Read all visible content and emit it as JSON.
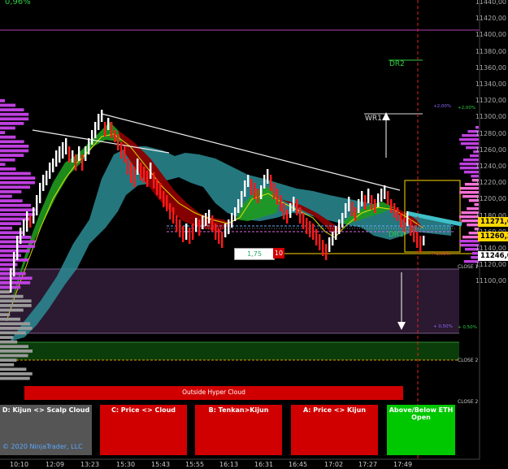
{
  "header": {
    "percent_change": "0,96%"
  },
  "price_axis": {
    "ticks": [
      "11440,00",
      "11420,00",
      "11400,00",
      "11380,00",
      "11360,00",
      "11340,00",
      "11320,00",
      "11300,00",
      "11280,00",
      "11260,00",
      "11240,00",
      "11220,00",
      "11200,00",
      "11180,00",
      "11160,00",
      "11140,00",
      "11120,00",
      "11100,00"
    ],
    "highlight_prices": [
      {
        "value": "11271,6",
        "color": "#ffd700"
      },
      {
        "value": "11260,3",
        "color": "#ffd700"
      },
      {
        "value": "11246,0",
        "color": "#ffffff"
      }
    ]
  },
  "time_axis": {
    "ticks": [
      "10:10",
      "12:09",
      "13:23",
      "15:30",
      "15:43",
      "15:55",
      "16:13",
      "16:31",
      "16:45",
      "17:02",
      "17:27",
      "17:49"
    ]
  },
  "annotations": {
    "wr1": "WR1",
    "dr1": "DR1",
    "dr2": "DR2",
    "close_1": "CLOSE 1",
    "close_2a": "CLOSE 2",
    "close_2b": "CLOSE 2",
    "pct_plus2_a": "+2,00%",
    "pct_plus2_b": "+2,00%",
    "pct_plus05_a": "+ 0,50%",
    "pct_plus05_b": "+ 0,50%",
    "pct_small": "+ 1,00%"
  },
  "controls": {
    "input_value": "1,75",
    "count_value": "10"
  },
  "hyper_cloud": {
    "label": "Outside Hyper Cloud"
  },
  "signals": [
    {
      "label": "D: Kijun <> Scalp Cloud",
      "color": "#555555"
    },
    {
      "label": "C: Price <> Cloud",
      "color": "#d00000"
    },
    {
      "label": "B: Tenkan>Kijun",
      "color": "#d00000"
    },
    {
      "label": "A: Price <> Kijun",
      "color": "#d00000"
    },
    {
      "label": "Above/Below ETH Open",
      "color": "#00c800"
    }
  ],
  "footer": {
    "copyright": "© 2020 NinjaTrader, LLC"
  },
  "colors": {
    "background": "#000000",
    "bull_candle": "#ffffff",
    "bear_candle": "#ff1a1a",
    "cloud_teal": "#2b8c94",
    "cloud_green": "#1f9a1f",
    "cloud_red": "#8b0000",
    "volume_profile": "#c040e0",
    "accent_yellow": "#ffd700"
  }
}
